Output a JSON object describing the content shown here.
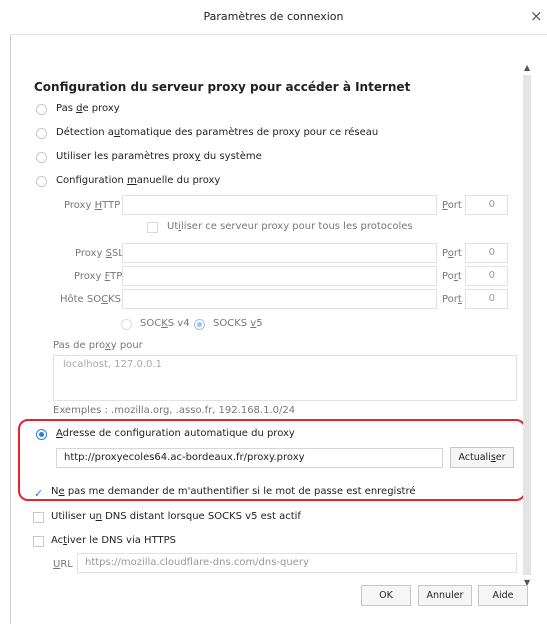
{
  "window": {
    "title": "Paramètres de connexion",
    "close_glyph": "×"
  },
  "section": {
    "title": "Configuration du serveur proxy pour accéder à Internet"
  },
  "proxy_options": {
    "no_proxy": "Pas de proxy",
    "auto_detect": "Détection automatique des paramètres de proxy pour ce réseau",
    "system": "Utiliser les paramètres proxy du système",
    "manual": "Configuration manuelle du proxy",
    "selected": "auto_config_url"
  },
  "manual": {
    "http_label": "Proxy HTTP",
    "port_label": "Port",
    "http_port": "0",
    "all_protocols": "Utiliser ce serveur proxy pour tous les protocoles",
    "ssl_label": "Proxy SSL",
    "ssl_port": "0",
    "ftp_label": "Proxy FTP",
    "ftp_port": "0",
    "socks_label": "Hôte SOCKS",
    "socks_port": "0",
    "socks_v4": "SOCKS v4",
    "socks_v5": "SOCKS v5",
    "socks_selected": "SOCKS v5"
  },
  "no_proxy_for": {
    "label": "Pas de proxy pour",
    "placeholder": "localhost, 127.0.0.1",
    "examples": "Exemples : .mozilla.org, .asso.fr, 192.168.1.0/24"
  },
  "auto_config": {
    "label": "Adresse de configuration automatique du proxy",
    "url": "http://proxyecoles64.ac-bordeaux.fr/proxy.proxy",
    "reload_button": "Actualiser"
  },
  "options": {
    "no_auth_prompt": "Ne pas me demander de m'authentifier si le mot de passe est enregistré",
    "no_auth_prompt_checked": true,
    "remote_dns": "Utiliser un DNS distant lorsque SOCKS v5 est actif",
    "remote_dns_checked": false,
    "doh": "Activer le DNS via HTTPS",
    "doh_checked": false,
    "doh_url_label": "URL",
    "doh_url": "https://mozilla.cloudflare-dns.com/dns-query"
  },
  "footer": {
    "ok": "OK",
    "cancel": "Annuler",
    "help": "Aide"
  },
  "colors": {
    "accent": "#2a7fdc",
    "highlight_border": "#e0242e"
  }
}
